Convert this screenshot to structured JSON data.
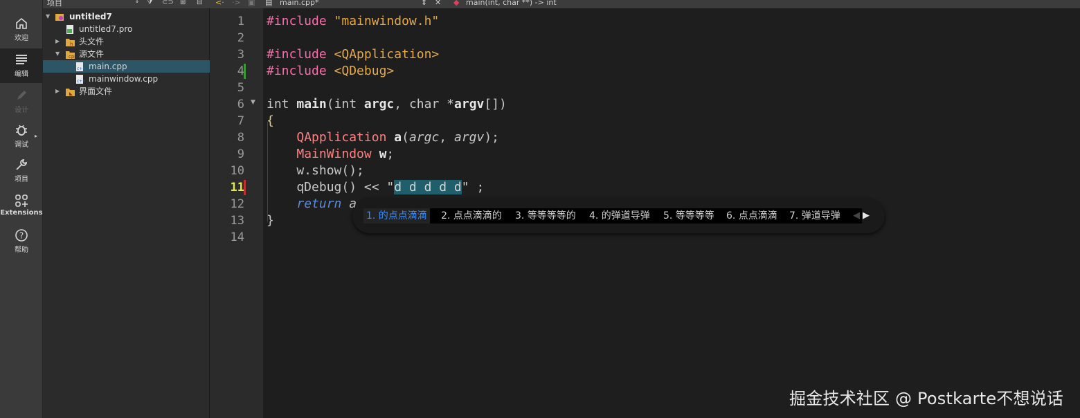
{
  "modebar": {
    "items": [
      {
        "label": "欢迎",
        "icon": "home-icon"
      },
      {
        "label": "编辑",
        "icon": "edit-icon"
      },
      {
        "label": "设计",
        "icon": "design-icon"
      },
      {
        "label": "调试",
        "icon": "debug-icon"
      },
      {
        "label": "项目",
        "icon": "wrench-icon"
      },
      {
        "label": "Extensions",
        "icon": "extensions-icon"
      },
      {
        "label": "帮助",
        "icon": "help-icon"
      }
    ]
  },
  "project_panel": {
    "title": "项目",
    "tree": [
      {
        "label": "untitled7"
      },
      {
        "label": "untitled7.pro"
      },
      {
        "label": "头文件"
      },
      {
        "label": "源文件"
      },
      {
        "label": "main.cpp"
      },
      {
        "label": "mainwindow.cpp"
      },
      {
        "label": "界面文件"
      }
    ]
  },
  "editor": {
    "file_name": "main.cpp*",
    "symbol": "main(int, char **) -> int",
    "line_numbers": [
      "1",
      "2",
      "3",
      "4",
      "5",
      "6",
      "7",
      "8",
      "9",
      "10",
      "11",
      "12",
      "13",
      "14"
    ],
    "current_line": "11",
    "lines": {
      "l1": [
        "#include",
        "\"mainwindow.h\""
      ],
      "l3": [
        "#include",
        "<QApplication>"
      ],
      "l4": [
        "#include",
        "<QDebug>"
      ],
      "l6": [
        "int",
        "main",
        "(",
        "int",
        "argc",
        ", ",
        "char",
        " *",
        "argv",
        "[])"
      ],
      "l7": "{",
      "l8": [
        "    ",
        "QApplication",
        "a",
        "(",
        "argc",
        ", ",
        "argv",
        ");"
      ],
      "l9": [
        "    ",
        "MainWindow",
        "w",
        ";"
      ],
      "l10": "    w.show();",
      "l11": [
        "    qDebug() << \"",
        "d d d d d",
        "\" ;"
      ],
      "l12": [
        "    ",
        "return",
        " a"
      ],
      "l13": "}"
    }
  },
  "ime": {
    "candidates": [
      "1. 的点点滴滴",
      "2. 点点滴滴的",
      "3. 等等等等的",
      "4. 的弹道导弹",
      "5. 等等等等",
      "6. 点点滴滴",
      "7. 弹道导弹"
    ]
  },
  "watermark": "掘金技术社区 @ Postkarte不想说话"
}
